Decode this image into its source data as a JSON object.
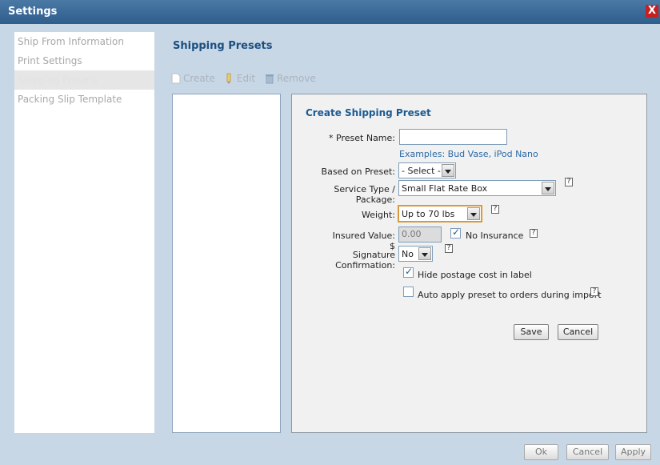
{
  "window": {
    "title": "Settings",
    "close_label": "X"
  },
  "sidebar": {
    "items": [
      {
        "label": "Ship From Information"
      },
      {
        "label": "Print Settings"
      },
      {
        "label": "Shipping Presets"
      },
      {
        "label": "Packing Slip Template"
      }
    ]
  },
  "content": {
    "title": "Shipping Presets",
    "toolbar": {
      "create": "Create",
      "edit": "Edit",
      "remove": "Remove"
    }
  },
  "form": {
    "title": "Create Shipping Preset",
    "preset_name_label": "* Preset Name:",
    "preset_name_value": "",
    "preset_name_hint": "Examples: Bud Vase, iPod Nano",
    "based_on_label": "Based on Preset:",
    "based_on_value": "- Select -",
    "service_label": "Service Type / Package:",
    "service_value": "Small Flat Rate Box",
    "weight_label": "Weight:",
    "weight_value": "Up to 70 lbs",
    "insured_label": "Insured Value: $",
    "insured_value": "0.00",
    "no_insurance_label": "No Insurance",
    "signature_label": "Signature Confirmation:",
    "signature_value": "No",
    "hide_postage_label": "Hide postage cost in label",
    "auto_apply_label": "Auto apply preset to orders during import",
    "help_glyph": "?",
    "save": "Save",
    "cancel": "Cancel"
  },
  "footer": {
    "ok": "Ok",
    "cancel": "Cancel",
    "apply": "Apply"
  }
}
